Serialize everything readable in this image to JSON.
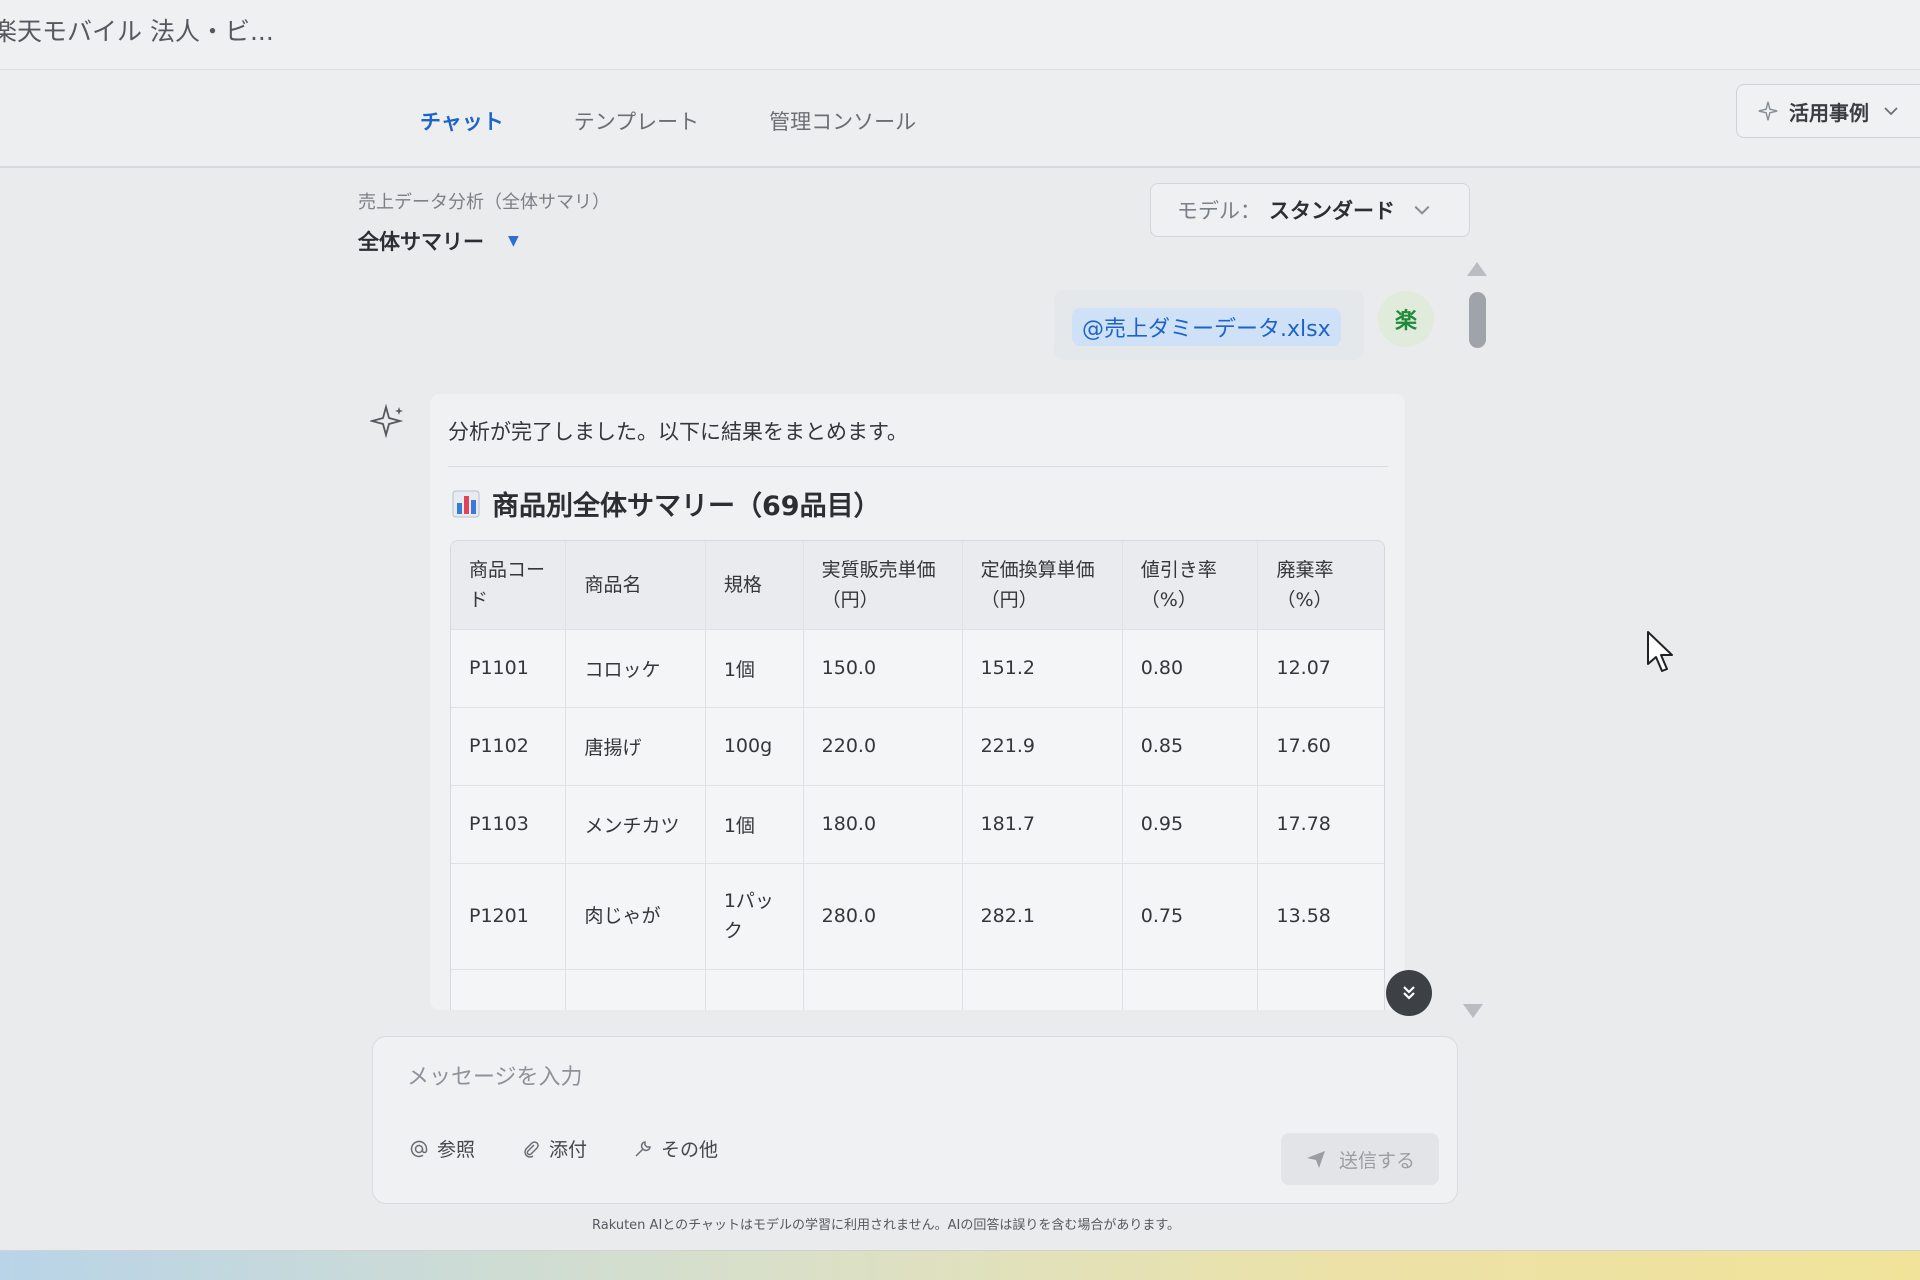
{
  "window": {
    "title": "楽天モバイル 法人・ビ..."
  },
  "nav": {
    "tabs": [
      {
        "label": "チャット",
        "active": true
      },
      {
        "label": "テンプレート",
        "active": false
      },
      {
        "label": "管理コンソール",
        "active": false
      }
    ],
    "cases_button": "活用事例"
  },
  "conversation": {
    "subtitle": "売上データ分析（全体サマリ）",
    "title": "全体サマリー",
    "model_label": "モデル：",
    "model_value": "スタンダード"
  },
  "user_message": {
    "mention": "@売上ダミーデータ.xlsx",
    "avatar": "楽"
  },
  "ai_response": {
    "intro": "分析が完了しました。以下に結果をまとめます。",
    "heading": "商品別全体サマリー（69品目）",
    "table": {
      "headers": [
        "商品コード",
        "商品名",
        "規格",
        "実質販売単価（円）",
        "定価換算単価（円）",
        "値引き率（%）",
        "廃棄率（%）"
      ],
      "rows": [
        [
          "P1101",
          "コロッケ",
          "1個",
          "150.0",
          "151.2",
          "0.80",
          "12.07"
        ],
        [
          "P1102",
          "唐揚げ",
          "100g",
          "220.0",
          "221.9",
          "0.85",
          "17.60"
        ],
        [
          "P1103",
          "メンチカツ",
          "1個",
          "180.0",
          "181.7",
          "0.95",
          "17.78"
        ],
        [
          "P1201",
          "肉じゃが",
          "1パック",
          "280.0",
          "282.1",
          "0.75",
          "13.58"
        ]
      ],
      "partial_row_text": "1パッ"
    }
  },
  "composer": {
    "placeholder": "メッセージを入力",
    "tools": [
      "参照",
      "添付",
      "その他"
    ],
    "send": "送信する"
  },
  "disclaimer": "Rakuten AIとのチャットはモデルの学習に利用されません。AIの回答は誤りを含む場合があります。",
  "colors": {
    "accent": "#1e64c8",
    "avatar": "#1f8a3a"
  }
}
